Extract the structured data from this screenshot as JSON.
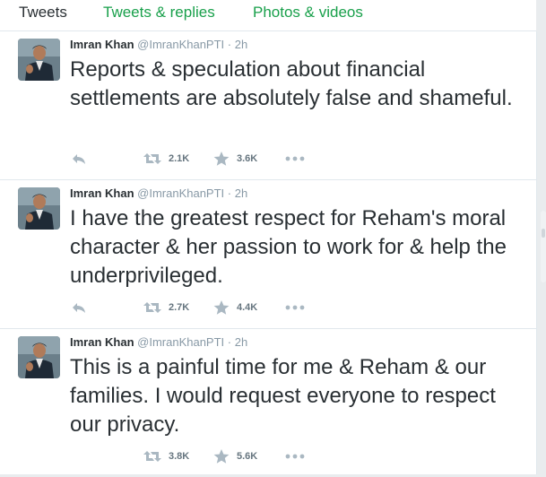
{
  "tabs": [
    {
      "label": "Tweets"
    },
    {
      "label": "Tweets & replies"
    },
    {
      "label": "Photos & videos"
    }
  ],
  "colors": {
    "link_green": "#19a04b",
    "muted_text": "#8899a6",
    "action_gray": "#aab8c2",
    "border": "#e1e8ed"
  },
  "icons": {
    "reply": "reply-icon",
    "retweet": "retweet-icon",
    "favorite": "star-icon",
    "more": "more-dots-icon"
  },
  "tweets": [
    {
      "fullname": "Imran Khan",
      "username": "@ImranKhanPTI",
      "separator": "·",
      "time": "2h",
      "text": "Reports & speculation about financial settlements are absolutely false and shameful.",
      "retweets": "2.1K",
      "favorites": "3.6K"
    },
    {
      "fullname": "Imran Khan",
      "username": "@ImranKhanPTI",
      "separator": "·",
      "time": "2h",
      "text": "I have the greatest respect for Reham's moral character & her passion to work for & help the underprivileged.",
      "retweets": "2.7K",
      "favorites": "4.4K"
    },
    {
      "fullname": "Imran Khan",
      "username": "@ImranKhanPTI",
      "separator": "·",
      "time": "2h",
      "text": "This is a painful time for me & Reham & our families. I would request everyone to respect our privacy.",
      "retweets": "3.8K",
      "favorites": "5.6K"
    }
  ]
}
